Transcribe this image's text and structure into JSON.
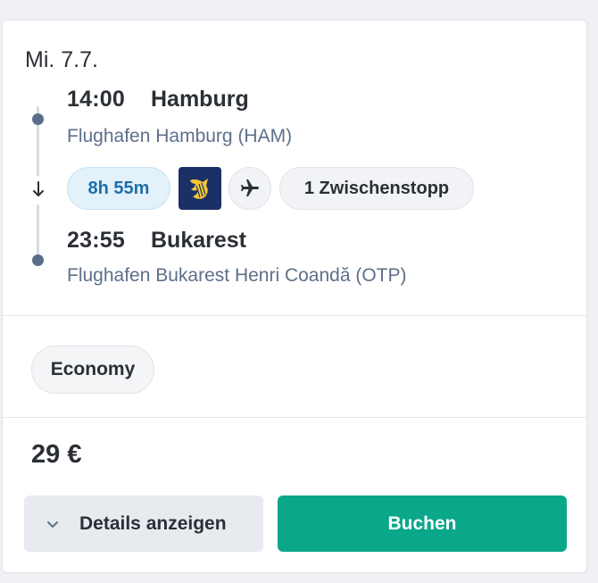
{
  "date": "Mi. 7.7.",
  "departure": {
    "time": "14:00",
    "city": "Hamburg",
    "airport": "Flughafen Hamburg (HAM)"
  },
  "arrival": {
    "time": "23:55",
    "city": "Bukarest",
    "airport": "Flughafen Bukarest Henri Coandă (OTP)"
  },
  "flight": {
    "duration": "8h 55m",
    "stops": "1 Zwischenstopp",
    "airline_icon": "ryanair-logo-icon",
    "mode_icon": "airplane-icon"
  },
  "fare_class": "Economy",
  "price": "29 €",
  "actions": {
    "details_label": "Details anzeigen",
    "book_label": "Buchen"
  },
  "colors": {
    "accent": "#0aa78b",
    "duration_bg": "#e3f1fb",
    "duration_text": "#1f6fa8",
    "airline_logo_bg": "#1b3066"
  }
}
